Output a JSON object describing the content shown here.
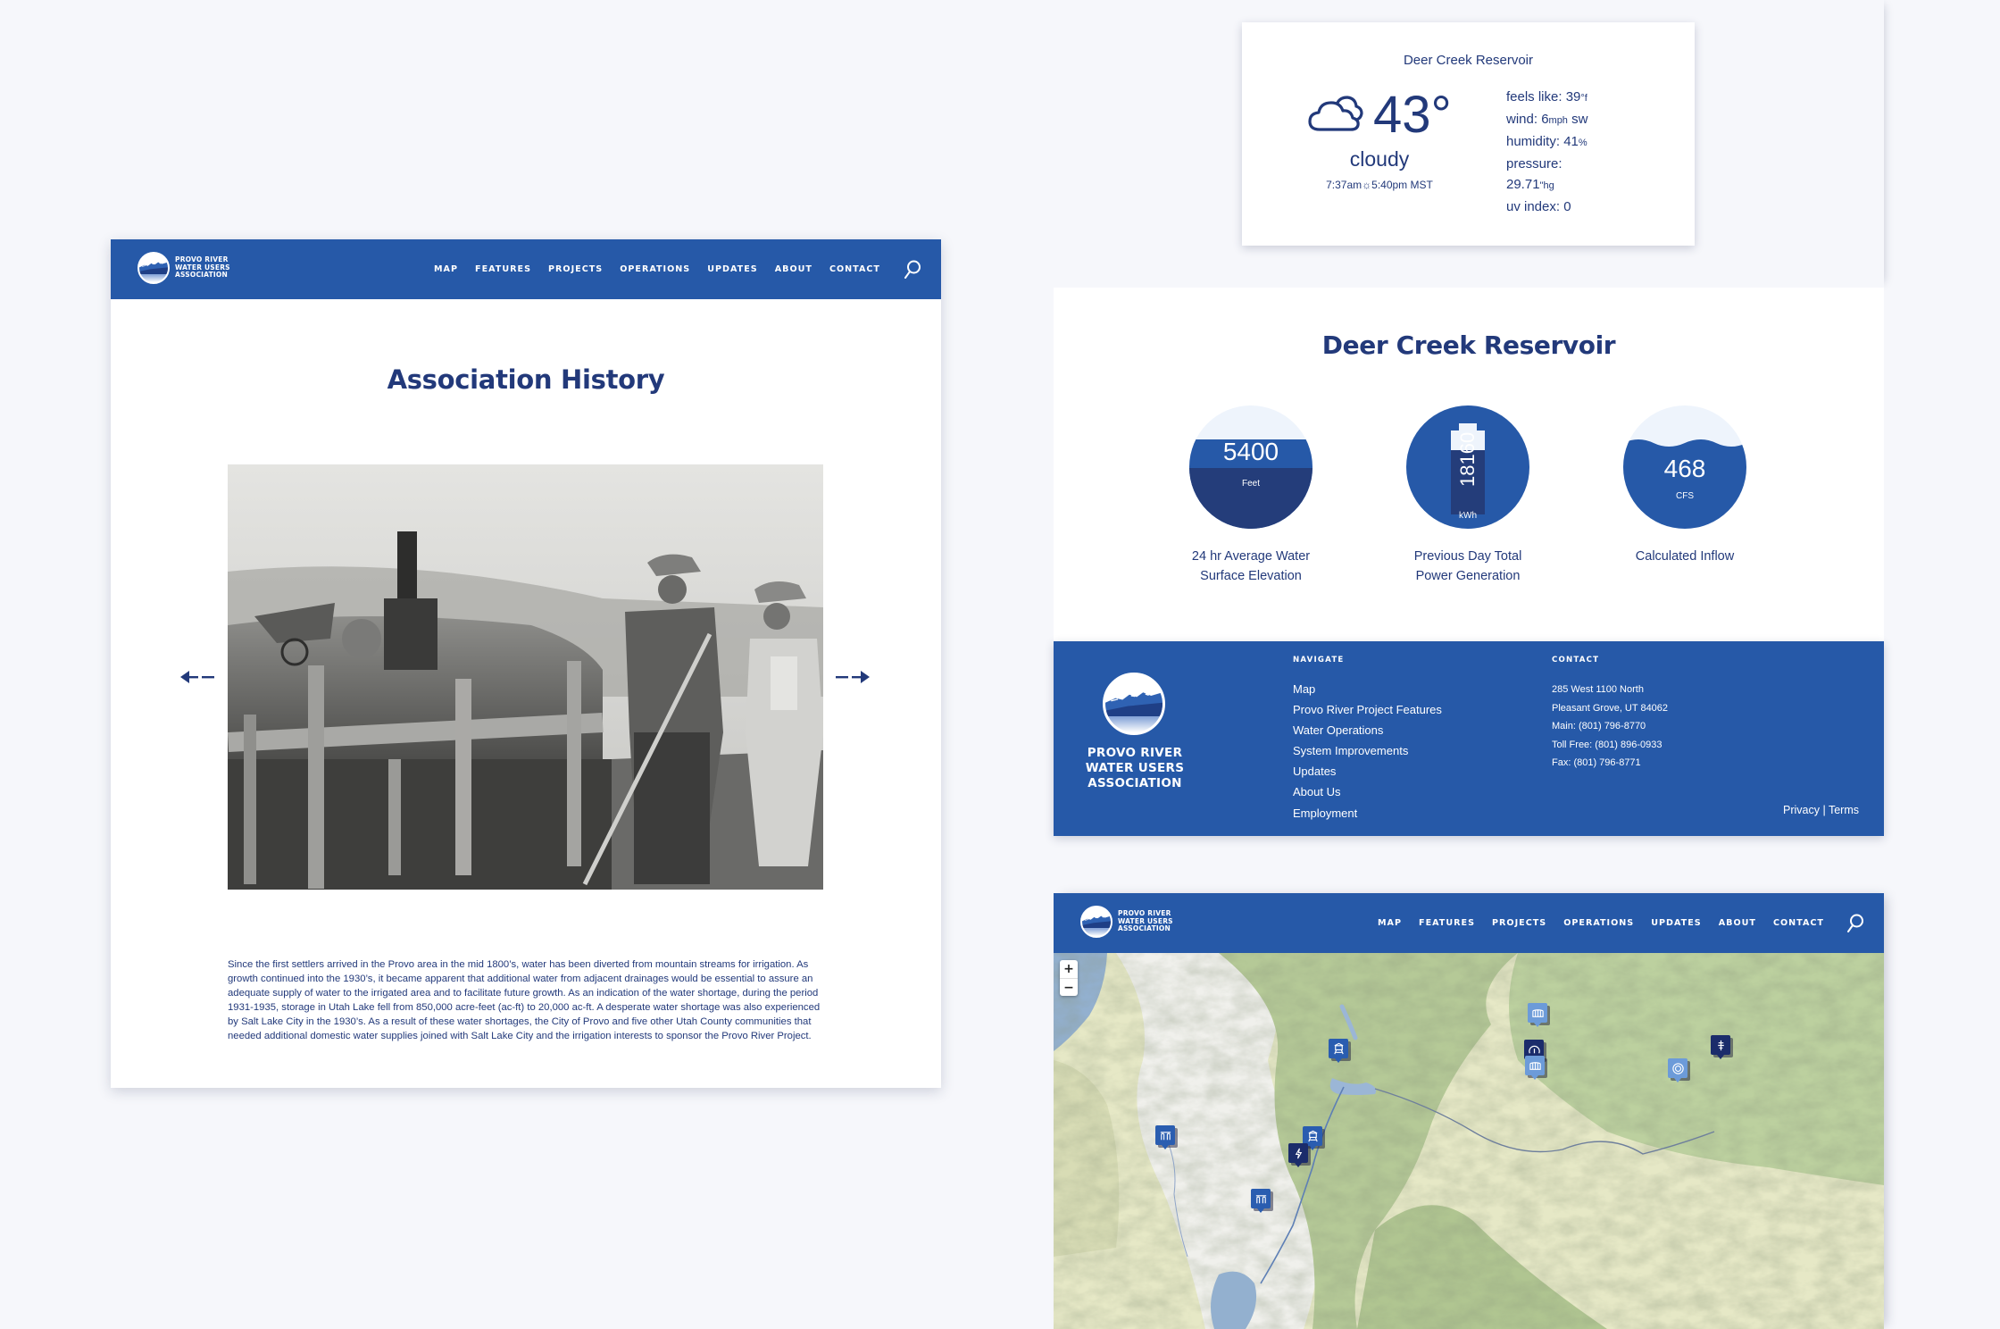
{
  "brand": {
    "org_name_lines": [
      "PROVO RIVER",
      "WATER USERS",
      "ASSOCIATION"
    ],
    "primary_color": "#2659a8",
    "text_color": "#22397a",
    "background_color": "#f6f7fb"
  },
  "nav": {
    "items": [
      "MAP",
      "FEATURES",
      "PROJECTS",
      "OPERATIONS",
      "UPDATES",
      "ABOUT",
      "CONTACT"
    ],
    "search_icon": "search-icon"
  },
  "history_page": {
    "title": "Association History",
    "photo_alt": "Historic black and white photo of workers building a concrete canal with a steam engine in the background",
    "prev_icon": "arrow-left-icon",
    "next_icon": "arrow-right-icon",
    "body": "Since the first settlers arrived in the Provo area in the mid 1800’s, water has been diverted from mountain streams for irrigation. As growth continued into the 1930’s, it became apparent that additional water from adjacent drainages would be essential to assure an adequate supply of water to the irrigated area and to facilitate future growth. As an indication of the water shortage, during the period 1931-1935, storage in Utah Lake fell from 850,000 acre-feet (ac-ft) to 20,000 ac-ft. A desperate water shortage was also experienced by Salt Lake City in the 1930’s. As a result of these water shortages, the City of Provo and five other Utah County communities that needed additional domestic water supplies joined with Salt Lake City and the irrigation interests to sponsor the Provo River Project."
  },
  "weather": {
    "location": "Deer Creek Reservoir",
    "icon": "cloud-icon",
    "temperature": "43°",
    "condition": "cloudy",
    "sunrise": "7:37am",
    "sunset": "5:40pm MST",
    "sun_icon": "☼",
    "details": {
      "feels_like_label": "feels like: ",
      "feels_like_value": "39",
      "feels_like_unit": "°f",
      "wind_label": "wind: ",
      "wind_value": "6",
      "wind_unit": "mph",
      "wind_dir": " sw",
      "humidity_label": "humidity: ",
      "humidity_value": "41",
      "humidity_unit": "%",
      "pressure_label": "pressure:",
      "pressure_value": "29.71",
      "pressure_unit": "\"hg",
      "uv_label": "uv index: ",
      "uv_value": "0"
    }
  },
  "reservoir": {
    "title": "Deer Creek Reservoir",
    "gauges": [
      {
        "value": "5400",
        "unit": "Feet",
        "label_lines": [
          "24 hr Average Water",
          "Surface Elevation"
        ],
        "fill_fraction": 0.72
      },
      {
        "value": "18160",
        "unit": "kWh",
        "label_lines": [
          "Previous Day Total",
          "Power Generation"
        ],
        "fill_fraction": 0.85
      },
      {
        "value": "468",
        "unit": "CFS",
        "label_lines": [
          "Calculated Inflow"
        ],
        "fill_fraction": 0.68
      }
    ]
  },
  "footer": {
    "navigate_heading": "NAVIGATE",
    "navigate_links": [
      "Map",
      "Provo River Project Features",
      "Water Operations",
      "System Improvements",
      "Updates",
      "About Us",
      "Employment"
    ],
    "contact_heading": "CONTACT",
    "contact_lines": [
      "285 West 1100 North",
      "Pleasant Grove, UT 84062",
      "Main: (801) 796-8770",
      "Toll Free: (801) 896-0933",
      "Fax: (801) 796-8771"
    ],
    "privacy": "Privacy",
    "separator": " | ",
    "terms": "Terms"
  },
  "map": {
    "zoom_in": "+",
    "zoom_out": "−",
    "pins": [
      {
        "name": "dam-pin",
        "icon": "dam-icon",
        "style": "light"
      },
      {
        "name": "water-tower-pin",
        "icon": "water-tower-icon",
        "style": "mid"
      },
      {
        "name": "gauge-pin",
        "icon": "gauge-icon",
        "style": "dark"
      },
      {
        "name": "dam-pin-2",
        "icon": "dam-icon",
        "style": "light"
      },
      {
        "name": "target-pin",
        "icon": "target-icon",
        "style": "light"
      },
      {
        "name": "tree-pin",
        "icon": "tree-icon",
        "style": "dark"
      },
      {
        "name": "treatment-plant-pin",
        "icon": "treatment-plant-icon",
        "style": "mid"
      },
      {
        "name": "water-tower-pin-2",
        "icon": "water-tower-icon",
        "style": "mid"
      },
      {
        "name": "power-pin",
        "icon": "lightning-icon",
        "style": "dark"
      },
      {
        "name": "treatment-plant-pin-2",
        "icon": "treatment-plant-icon",
        "style": "mid"
      }
    ]
  }
}
